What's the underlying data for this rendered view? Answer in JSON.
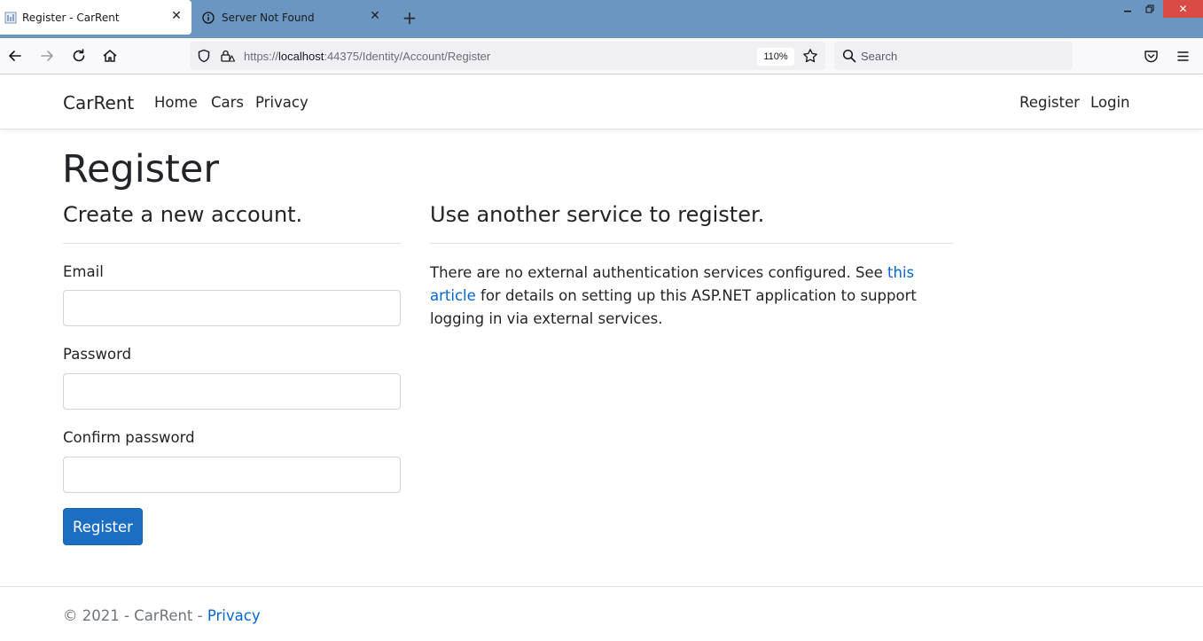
{
  "browser": {
    "tabs": [
      {
        "title": "Register - CarRent",
        "active": true
      },
      {
        "title": "Server Not Found",
        "active": false
      }
    ],
    "address": {
      "scheme": "https://",
      "host": "localhost",
      "rest": ":44375/Identity/Account/Register"
    },
    "zoom": "110%",
    "search_placeholder": "Search",
    "colors": {
      "tabbar": "#6b96c1",
      "close": "#d94b45"
    }
  },
  "site": {
    "brand": "CarRent",
    "nav": {
      "home": "Home",
      "cars": "Cars",
      "privacy": "Privacy",
      "register": "Register",
      "login": "Login"
    },
    "page_title": "Register",
    "form": {
      "heading": "Create a new account.",
      "email_label": "Email",
      "password_label": "Password",
      "confirm_label": "Confirm password",
      "submit": "Register"
    },
    "external": {
      "heading": "Use another service to register.",
      "text_before": "There are no external authentication services configured. See ",
      "link": "this article",
      "text_after": " for details on setting up this ASP.NET application to support logging in via external services."
    },
    "footer": {
      "text": "© 2021 - CarRent - ",
      "link": "Privacy"
    },
    "colors": {
      "primary": "#1b6ec2",
      "link": "#0366d6"
    }
  }
}
